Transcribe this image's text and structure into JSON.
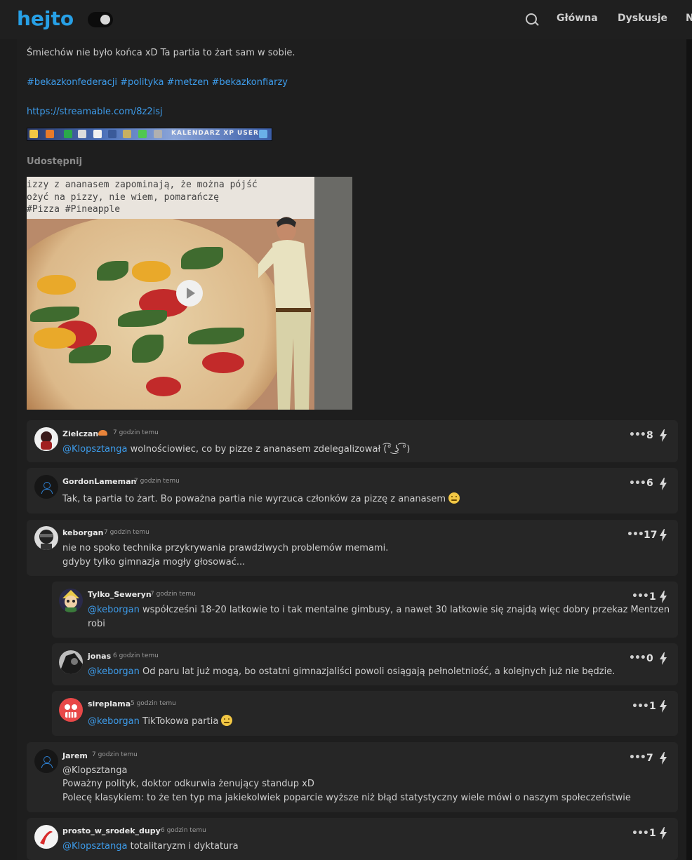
{
  "header": {
    "logo": "hejto",
    "nav": [
      "Główna",
      "Dyskusje",
      "N"
    ]
  },
  "post": {
    "text": "Śmiechów nie było końca xD Ta partia to żart sam w sobie.",
    "tags": "#bekazkonfederacji #polityka #metzen #bekazkonfiarzy",
    "url": "https://streamable.com/8z2isj",
    "banner_text": "KALENDARZ XP USER",
    "share_label": "Udostępnij",
    "video_caption_1": "izzy z ananasem zapominają, że można pójść",
    "video_caption_2": "ożyć na pizzy, nie wiem, pomarańczę",
    "video_caption_3": "#Pizza #Pineapple"
  },
  "comments": [
    {
      "user": "Zielczan",
      "time": "7 godzin temu",
      "mention": "@Klopsztanga",
      "text": " wolnościowiec, co by pizze z ananasem zdelegalizował (͡° ͜ʖ ͡°)",
      "votes": "8"
    },
    {
      "user": "GordonLameman",
      "time": "7 godzin temu",
      "mention": "",
      "text": "Tak, ta partia to żart. Bo poważna partia nie wyrzuca członków za pizzę z ananasem",
      "votes": "6"
    },
    {
      "user": "keborgan",
      "time": "7 godzin temu",
      "mention": "",
      "text": "nie no spoko technika przykrywania prawdziwych problemów memami.",
      "text2": "gdyby tylko gimnazja mogły głosować...",
      "votes": "17"
    },
    {
      "user": "Tylko_Seweryn",
      "time": "7 godzin temu",
      "mention": "@keborgan",
      "text": " współcześni 18-20 latkowie to i tak mentalne gimbusy, a nawet 30 latkowie się znajdą więc dobry przekaz Mentzen",
      "text2": "robi",
      "votes": "1"
    },
    {
      "user": "jonas",
      "time": "6 godzin temu",
      "mention": "@keborgan",
      "text": " Od paru lat już mogą, bo ostatni gimnazjaliści powoli osiągają pełnoletniość, a kolejnych już nie będzie.",
      "votes": "0"
    },
    {
      "user": "sireplama",
      "time": "5 godzin temu",
      "mention": "@keborgan",
      "text": " TikTokowa partia",
      "votes": "1"
    },
    {
      "user": "Jarem",
      "time": "7 godzin temu",
      "mention": "@Klopsztanga",
      "text": "Poważny polityk, doktor odkurwia żenujący standup xD",
      "text2": "Polecę klasykiem: to że ten typ ma jakiekolwiek poparcie wyższe niż błąd statystyczny wiele mówi o naszym społeczeństwie",
      "votes": "7"
    },
    {
      "user": "prosto_w_srodek_dupy",
      "time": "6 godzin temu",
      "mention": "@Klopsztanga",
      "text": " totalitaryzm i dyktatura",
      "votes": "1"
    }
  ],
  "colors": {
    "accent": "#27a0e6",
    "link": "#3d9be9",
    "background": "#141414",
    "panel": "#1e1e1e",
    "card": "#262626"
  }
}
